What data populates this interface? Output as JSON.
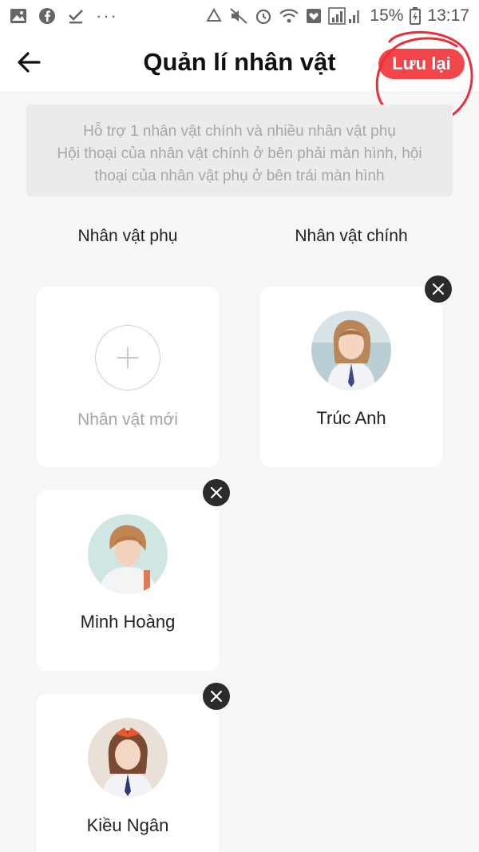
{
  "status_bar": {
    "battery": "15%",
    "time": "13:17"
  },
  "header": {
    "title": "Quản lí nhân vật",
    "save_label": "Lưu lại"
  },
  "info": {
    "line1": "Hỗ trợ 1 nhân vật chính và nhiều nhân vật phụ",
    "line2": "Hội thoại của nhân vật chính ở bên phải màn hình, hội",
    "line3": "thoại của nhân vật phụ ở bên trái màn hình"
  },
  "columns": {
    "secondary_title": "Nhân vật phụ",
    "main_title": "Nhân vật chính"
  },
  "add_character": {
    "label": "Nhân vật mới"
  },
  "main_characters": [
    {
      "name": "Trúc Anh"
    }
  ],
  "secondary_characters": [
    {
      "name": "Minh Hoàng"
    },
    {
      "name": "Kiều Ngân"
    }
  ],
  "colors": {
    "accent": "#f2464a"
  }
}
